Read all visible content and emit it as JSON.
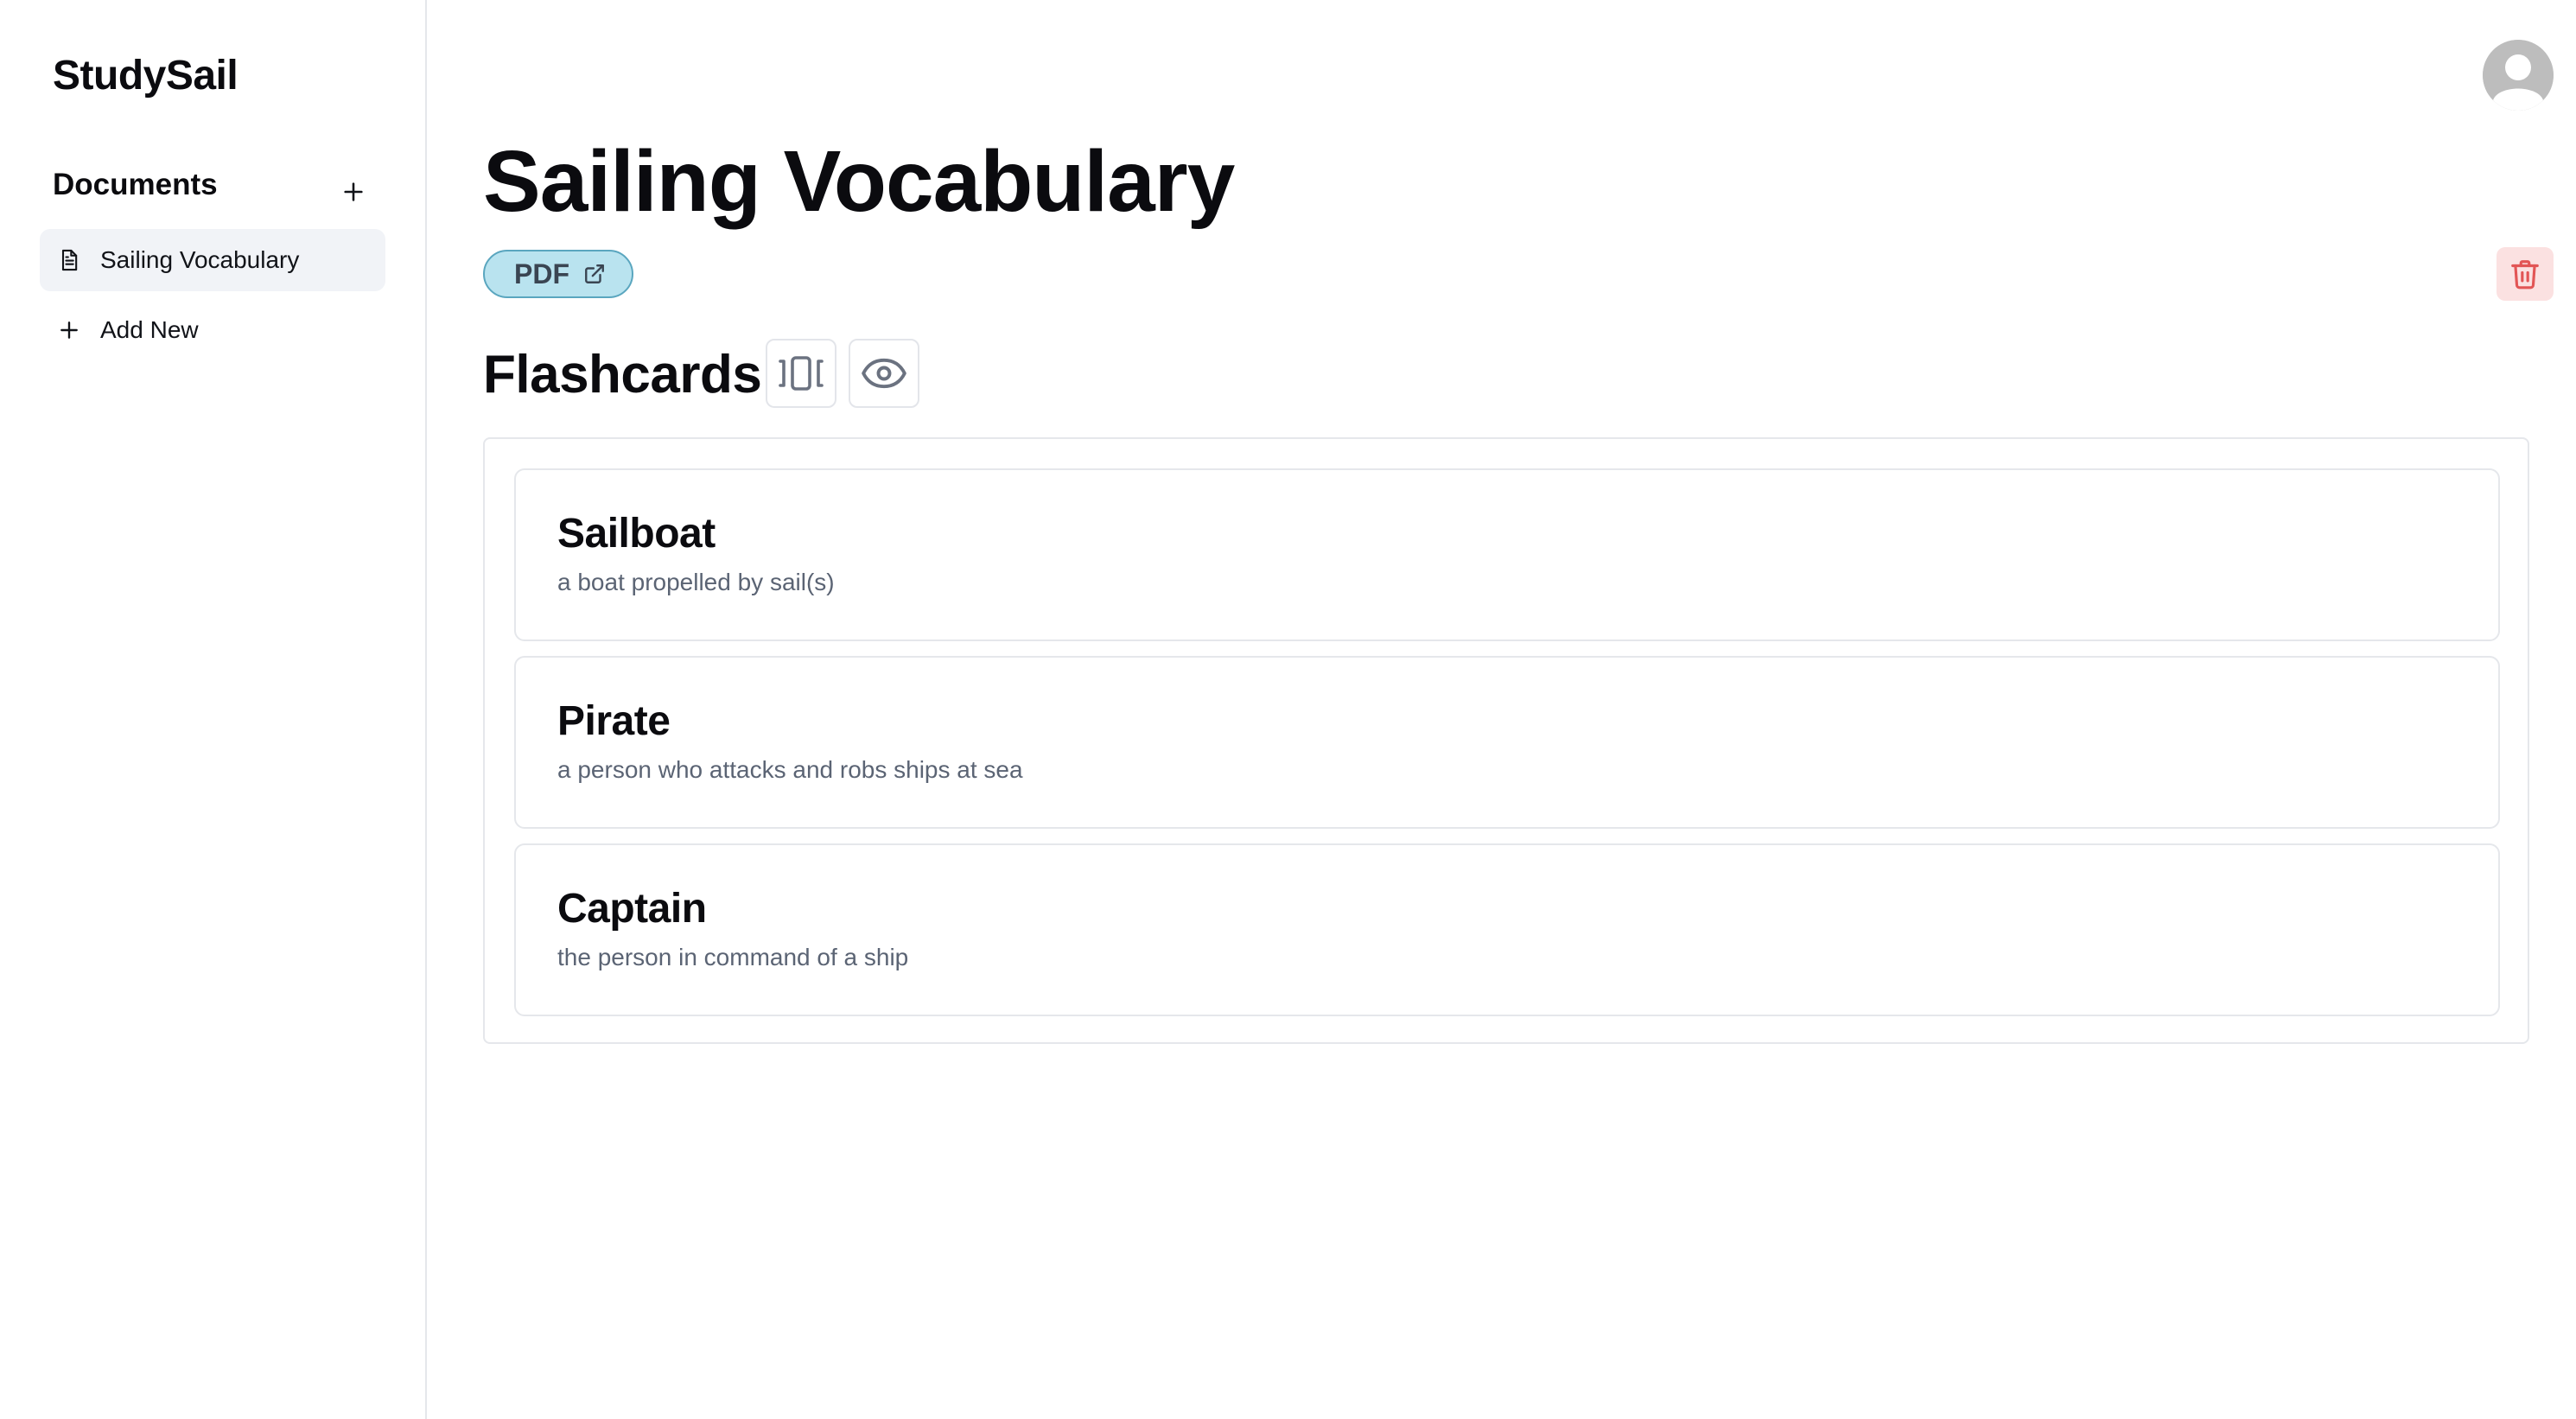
{
  "app": {
    "brand": "StudySail"
  },
  "sidebar": {
    "section_title": "Documents",
    "items": [
      {
        "label": "Sailing Vocabulary",
        "icon": "document-icon",
        "active": true
      }
    ],
    "add_new_label": "Add New"
  },
  "document": {
    "title": "Sailing Vocabulary",
    "badge_label": "PDF"
  },
  "flashcards": {
    "title": "Flashcards",
    "cards": [
      {
        "term": "Sailboat",
        "definition": "a boat propelled by sail(s)"
      },
      {
        "term": "Pirate",
        "definition": "a person who attacks and robs ships at sea"
      },
      {
        "term": "Captain",
        "definition": "the person in command of a ship"
      }
    ]
  },
  "icons": {
    "add": "plus-icon",
    "badge": "external-link-icon",
    "delete": "trash-icon",
    "carousel": "carousel-icon",
    "preview": "eye-icon",
    "avatar": "user-avatar-icon"
  },
  "colors": {
    "badge_bg": "#b9e3ef",
    "badge_border": "#5aa6bf",
    "delete_bg": "#fbe1e1",
    "delete_icon": "#e25555",
    "active_nav_bg": "#f1f3f7"
  }
}
